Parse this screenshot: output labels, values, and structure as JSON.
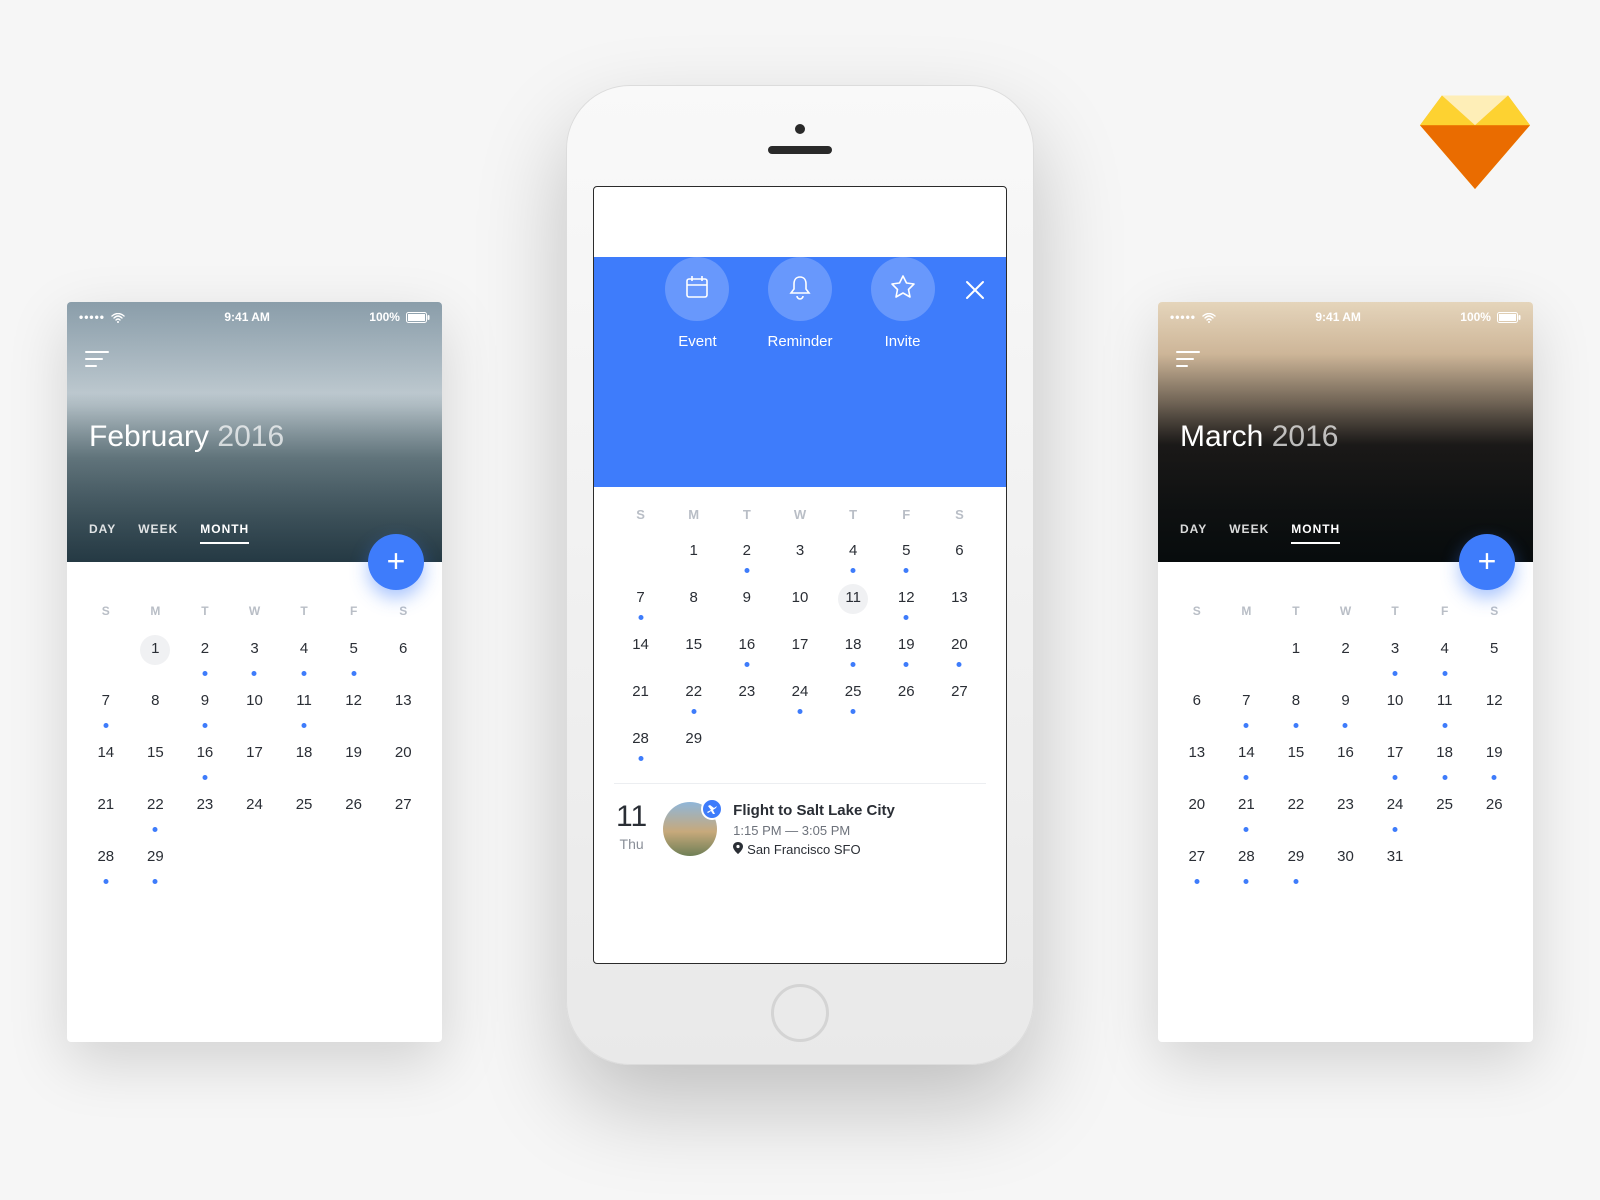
{
  "statusbar": {
    "time": "9:41 AM",
    "battery": "100%"
  },
  "views": {
    "day": "DAY",
    "week": "WEEK",
    "month": "MONTH"
  },
  "dow": [
    "S",
    "M",
    "T",
    "W",
    "T",
    "F",
    "S"
  ],
  "left": {
    "month": "February",
    "year": "2016",
    "startBlank": 1,
    "days": 29,
    "selected": 1,
    "dots": [
      2,
      3,
      4,
      5,
      7,
      9,
      11,
      16,
      22,
      28,
      29
    ]
  },
  "right": {
    "month": "March",
    "year": "2016",
    "startBlank": 2,
    "days": 31,
    "selected": 0,
    "dots": [
      3,
      4,
      7,
      8,
      9,
      11,
      14,
      17,
      18,
      19,
      21,
      24,
      27,
      28,
      29
    ]
  },
  "center": {
    "actions": {
      "event": "Event",
      "reminder": "Reminder",
      "invite": "Invite"
    },
    "startBlank": 1,
    "days": 29,
    "selected": 11,
    "dots": [
      2,
      4,
      5,
      7,
      12,
      16,
      18,
      19,
      20,
      22,
      24,
      25,
      28
    ]
  },
  "event": {
    "dayNum": "11",
    "dayName": "Thu",
    "title": "Flight to Salt Lake City",
    "time": "1:15 PM — 3:05 PM",
    "location": "San Francisco SFO"
  },
  "colors": {
    "accent": "#3E7CFB"
  }
}
